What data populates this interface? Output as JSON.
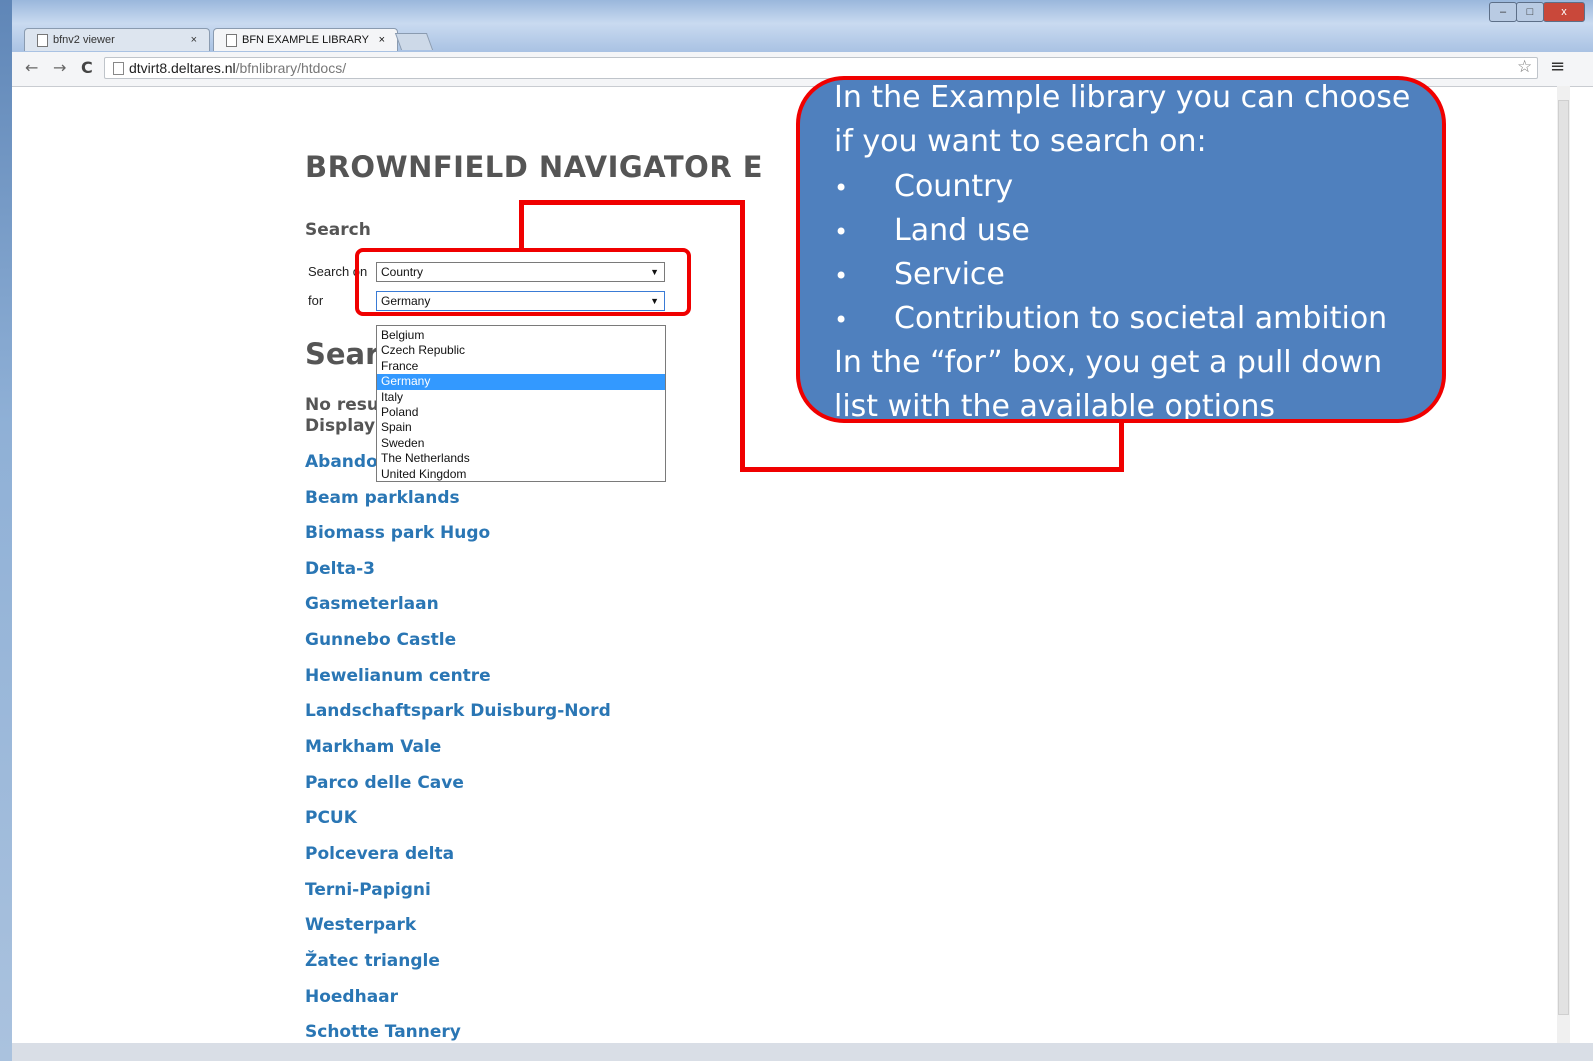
{
  "browser": {
    "tabs": [
      {
        "label": "bfnv2 viewer",
        "close": "×"
      },
      {
        "label": "BFN EXAMPLE LIBRARY",
        "close": "×"
      }
    ],
    "nav": {
      "back": "←",
      "forward": "→",
      "reload": "C"
    },
    "url": {
      "host": "dtvirt8.deltares.nl",
      "path": "/bfnlibrary/htdocs/"
    },
    "star": "☆",
    "menu": "≡",
    "window_buttons": {
      "minimize": "–",
      "maximize": "□",
      "close": "x"
    }
  },
  "page": {
    "title": "BROWNFIELD NAVIGATOR E",
    "search_heading": "Search",
    "search_on_label": "Search on",
    "for_label": "for",
    "search_on_value": "Country",
    "for_value": "Germany",
    "arrow": "▼",
    "dropdown_options": [
      "Belgium",
      "Czech Republic",
      "France",
      "Germany",
      "Italy",
      "Poland",
      "Spain",
      "Sweden",
      "The Netherlands",
      "United Kingdom"
    ],
    "selected_option": "Germany",
    "results_heading": "Sear",
    "no_results": "No resu",
    "display": "Display",
    "results": [
      "Abando",
      "Beam parklands",
      "Biomass park Hugo",
      "Delta-3",
      "Gasmeterlaan",
      "Gunnebo Castle",
      "Hewelianum centre",
      "Landschaftspark Duisburg-Nord",
      "Markham Vale",
      "Parco delle Cave",
      "PCUK",
      "Polcevera delta",
      "Terni-Papigni",
      "Westerpark",
      "Žatec triangle",
      "Hoedhaar",
      "Schotte Tannery"
    ]
  },
  "callout": {
    "line1": "In the Example library you can choose",
    "line2": "if you want to search on:",
    "bullet": "•",
    "items": [
      "Country",
      "Land use",
      "Service",
      "Contribution to societal ambition"
    ],
    "line3": "In the “for” box, you get a pull down",
    "line4": "list with the available options"
  },
  "colors": {
    "link": "#2a76b4",
    "callout_bg": "#4f80be",
    "highlight": "#f00000",
    "selected_option": "#3399ff"
  }
}
